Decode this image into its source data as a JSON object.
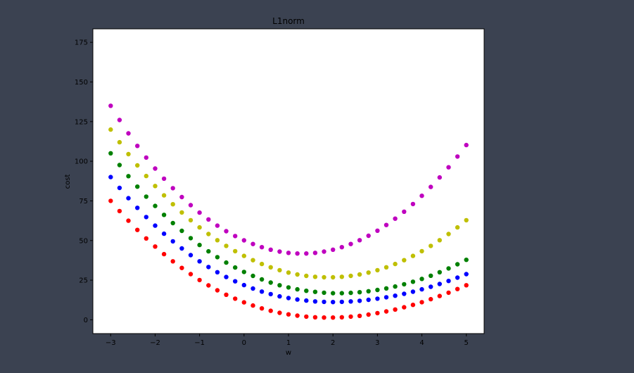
{
  "window": {
    "background": "#3b4251"
  },
  "chart_data": {
    "type": "scatter",
    "title": "L1norm",
    "xlabel": "w",
    "ylabel": "cost",
    "xlim": [
      -3.4,
      5.4
    ],
    "ylim": [
      -8.7,
      183.5
    ],
    "xticks": [
      -3,
      -2,
      -1,
      0,
      1,
      2,
      3,
      4,
      5
    ],
    "xtick_labels": [
      "−3",
      "−2",
      "−1",
      "0",
      "1",
      "2",
      "3",
      "4",
      "5"
    ],
    "yticks": [
      0,
      25,
      50,
      75,
      100,
      125,
      150,
      175
    ],
    "ytick_labels": [
      "0",
      "25",
      "50",
      "75",
      "100",
      "125",
      "150",
      "175"
    ],
    "grid": false,
    "legend": "none",
    "x": [
      -3.0,
      -2.8,
      -2.6,
      -2.4,
      -2.2,
      -2.0,
      -1.8,
      -1.6,
      -1.4,
      -1.2,
      -1.0,
      -0.8,
      -0.6,
      -0.4,
      -0.2,
      0.0,
      0.2,
      0.4,
      0.6,
      0.8,
      1.0,
      1.2,
      1.4,
      1.6,
      1.8,
      2.0,
      2.2,
      2.4,
      2.6,
      2.8,
      3.0,
      3.2,
      3.4,
      3.6,
      3.8,
      4.0,
      4.2,
      4.4,
      4.6,
      4.8,
      5.0
    ],
    "series": [
      {
        "color": "#ff0000",
        "y": [
          75.0,
          68.6,
          62.5,
          56.7,
          51.3,
          46.2,
          41.4,
          36.9,
          32.7,
          28.8,
          25.1,
          21.7,
          18.6,
          15.8,
          13.3,
          11.0,
          9.0,
          7.2,
          5.7,
          4.4,
          3.4,
          2.6,
          2.0,
          1.6,
          1.4,
          1.4,
          1.6,
          2.0,
          2.5,
          3.3,
          4.2,
          5.3,
          6.5,
          7.9,
          9.4,
          11.1,
          13.0,
          15.0,
          17.1,
          19.4,
          21.8
        ]
      },
      {
        "color": "#0000ff",
        "y": [
          90.0,
          83.2,
          76.7,
          70.6,
          64.8,
          59.4,
          54.3,
          49.5,
          45.0,
          40.8,
          36.9,
          33.3,
          30.0,
          27.0,
          24.3,
          21.9,
          19.7,
          17.8,
          16.2,
          14.8,
          13.7,
          12.8,
          12.1,
          11.6,
          11.3,
          11.2,
          11.3,
          11.6,
          12.0,
          12.6,
          13.3,
          14.2,
          15.2,
          16.4,
          17.7,
          19.2,
          20.8,
          22.6,
          24.5,
          26.6,
          28.8
        ]
      },
      {
        "color": "#008000",
        "y": [
          105.0,
          97.6,
          90.6,
          84.0,
          77.7,
          71.8,
          66.2,
          61.0,
          56.1,
          51.5,
          47.2,
          43.2,
          39.5,
          36.1,
          33.0,
          30.2,
          27.7,
          25.5,
          23.5,
          21.8,
          20.4,
          19.2,
          18.3,
          17.6,
          17.1,
          16.8,
          16.8,
          17.0,
          17.4,
          18.0,
          18.8,
          19.8,
          21.0,
          22.4,
          24.0,
          25.8,
          27.8,
          30.0,
          32.4,
          35.0,
          37.8
        ]
      },
      {
        "color": "#bfbf00",
        "y": [
          120.0,
          112.0,
          104.5,
          97.4,
          90.7,
          84.4,
          78.5,
          72.9,
          67.7,
          62.8,
          58.3,
          54.1,
          50.2,
          46.6,
          43.3,
          40.3,
          37.6,
          35.2,
          33.1,
          31.3,
          29.8,
          28.6,
          27.7,
          27.1,
          26.8,
          26.8,
          27.1,
          27.7,
          28.6,
          29.8,
          31.3,
          33.1,
          35.2,
          37.6,
          40.3,
          43.3,
          46.6,
          50.2,
          54.1,
          58.3,
          62.8
        ]
      },
      {
        "color": "#bf00bf",
        "y": [
          135.0,
          126.0,
          117.6,
          109.7,
          102.3,
          95.4,
          89.0,
          83.0,
          77.4,
          72.3,
          67.6,
          63.3,
          59.4,
          55.9,
          52.8,
          50.1,
          47.8,
          45.8,
          44.2,
          43.0,
          42.2,
          41.8,
          41.8,
          42.2,
          43.0,
          44.2,
          45.8,
          47.8,
          50.2,
          53.0,
          56.2,
          59.8,
          63.8,
          68.2,
          73.0,
          78.2,
          83.8,
          89.8,
          96.2,
          103.0,
          110.2
        ]
      }
    ]
  }
}
